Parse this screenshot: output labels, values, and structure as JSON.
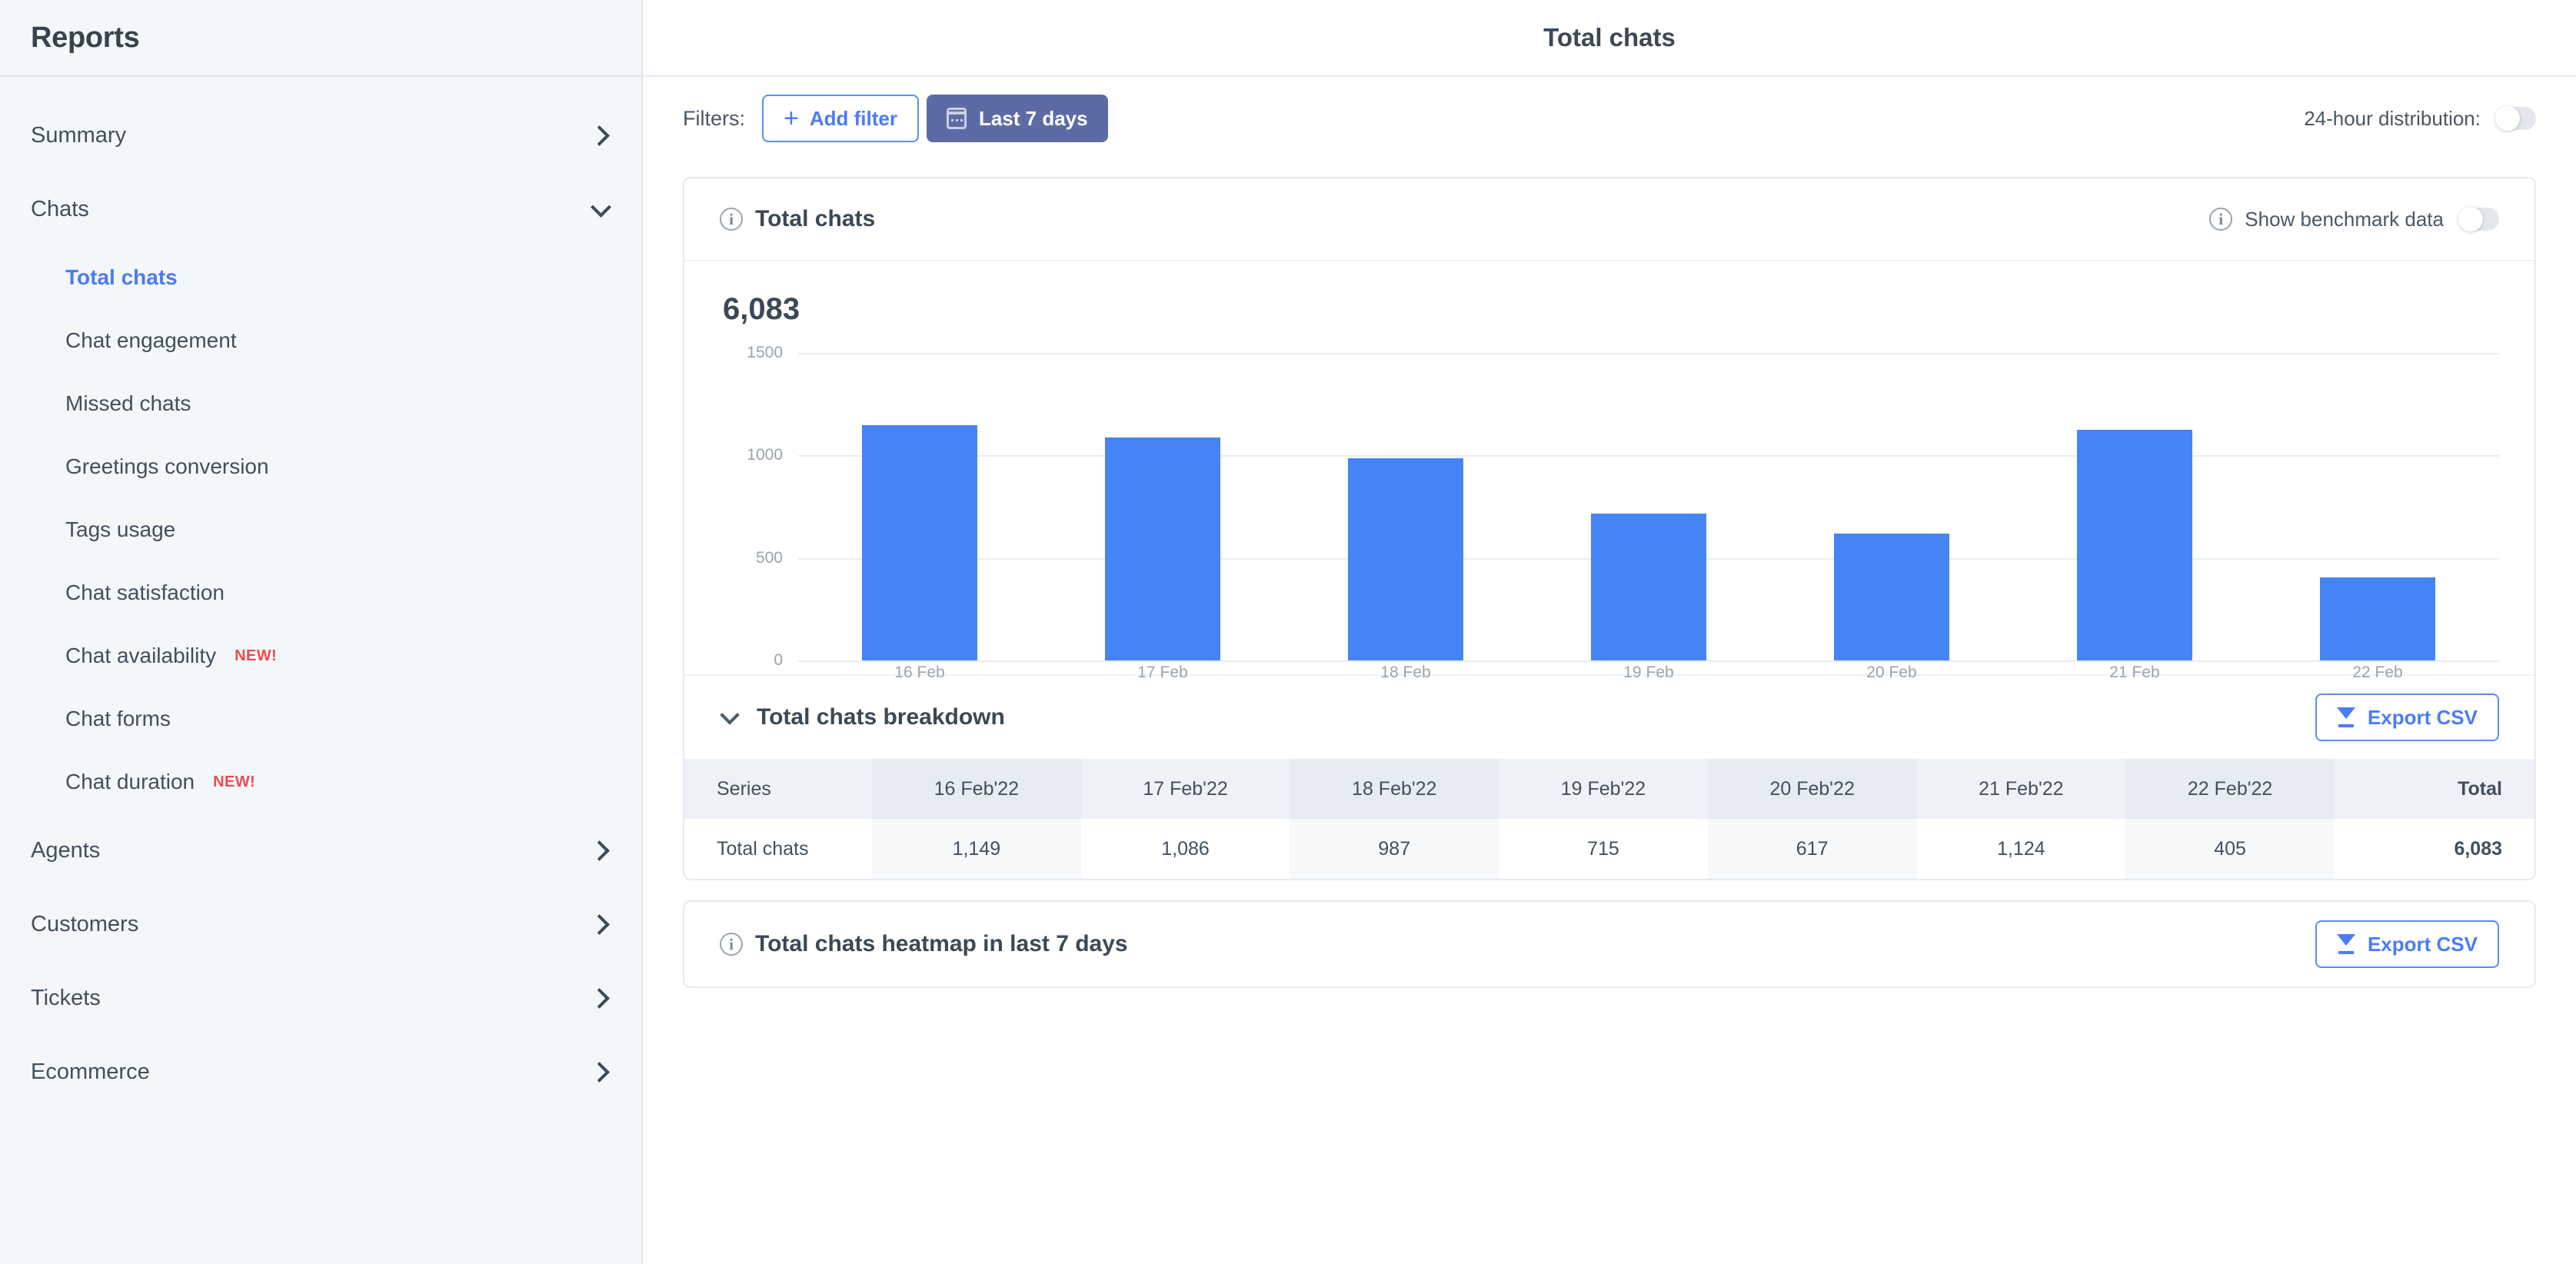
{
  "sidebar": {
    "title": "Reports",
    "groups": [
      {
        "label": "Summary",
        "icon": "chevron-right-icon",
        "expanded": false
      },
      {
        "label": "Chats",
        "icon": "chevron-down-icon",
        "expanded": true
      }
    ],
    "chat_items": [
      {
        "label": "Total chats",
        "badge": "",
        "active": true
      },
      {
        "label": "Chat engagement",
        "badge": "",
        "active": false
      },
      {
        "label": "Missed chats",
        "badge": "",
        "active": false
      },
      {
        "label": "Greetings conversion",
        "badge": "",
        "active": false
      },
      {
        "label": "Tags usage",
        "badge": "",
        "active": false
      },
      {
        "label": "Chat satisfaction",
        "badge": "",
        "active": false
      },
      {
        "label": "Chat availability",
        "badge": "NEW!",
        "active": false
      },
      {
        "label": "Chat forms",
        "badge": "",
        "active": false
      },
      {
        "label": "Chat duration",
        "badge": "NEW!",
        "active": false
      }
    ],
    "bottom_groups": [
      {
        "label": "Agents",
        "icon": "chevron-right-icon"
      },
      {
        "label": "Customers",
        "icon": "chevron-right-icon"
      },
      {
        "label": "Tickets",
        "icon": "chevron-right-icon"
      },
      {
        "label": "Ecommerce",
        "icon": "chevron-right-icon"
      }
    ],
    "badge_color": "#ec4a50",
    "active_color": "#4a7cf5"
  },
  "header": {
    "title": "Total chats"
  },
  "filterbar": {
    "filters_label": "Filters:",
    "add_filter_label": "Add filter",
    "add_filter_icon": "plus-icon",
    "date_range_label": "Last 7 days",
    "date_range_icon": "calendar-icon",
    "date_range_color": "#5d6ba5",
    "distribution_label": "24-hour distribution:",
    "distribution_on": false
  },
  "chart_card": {
    "title": "Total chats",
    "info_icon": "info-icon",
    "benchmark_label": "Show benchmark data",
    "benchmark_on": false,
    "total_value": "6,083"
  },
  "chart_data": {
    "type": "bar",
    "title": "Total chats",
    "categories": [
      "16 Feb",
      "17 Feb",
      "18 Feb",
      "19 Feb",
      "20 Feb",
      "21 Feb",
      "22 Feb"
    ],
    "values": [
      1149,
      1086,
      987,
      715,
      617,
      1124,
      405
    ],
    "series": [
      {
        "name": "Total chats",
        "values": [
          1149,
          1086,
          987,
          715,
          617,
          1124,
          405
        ]
      }
    ],
    "xlabel": "",
    "ylabel": "",
    "ylim": [
      0,
      1500
    ],
    "yticks": [
      0,
      500,
      1000,
      1500
    ],
    "ytick_labels": [
      "0",
      "500",
      "1000",
      "1500"
    ],
    "grid": true,
    "legend": false,
    "bar_color": "#4584f4",
    "total": 6083
  },
  "breakdown": {
    "title": "Total chats breakdown",
    "caret_icon": "chevron-down-icon",
    "export_label": "Export CSV",
    "export_icon": "download-icon",
    "columns": [
      "Series",
      "16 Feb'22",
      "17 Feb'22",
      "18 Feb'22",
      "19 Feb'22",
      "20 Feb'22",
      "21 Feb'22",
      "22 Feb'22",
      "Total"
    ],
    "rows": [
      {
        "series": "Total chats",
        "values": [
          "1,149",
          "1,086",
          "987",
          "715",
          "617",
          "1,124",
          "405"
        ],
        "total": "6,083"
      }
    ]
  },
  "heatmap_card": {
    "title": "Total chats heatmap in last 7 days",
    "info_icon": "info-icon",
    "export_label": "Export CSV",
    "export_icon": "download-icon"
  }
}
